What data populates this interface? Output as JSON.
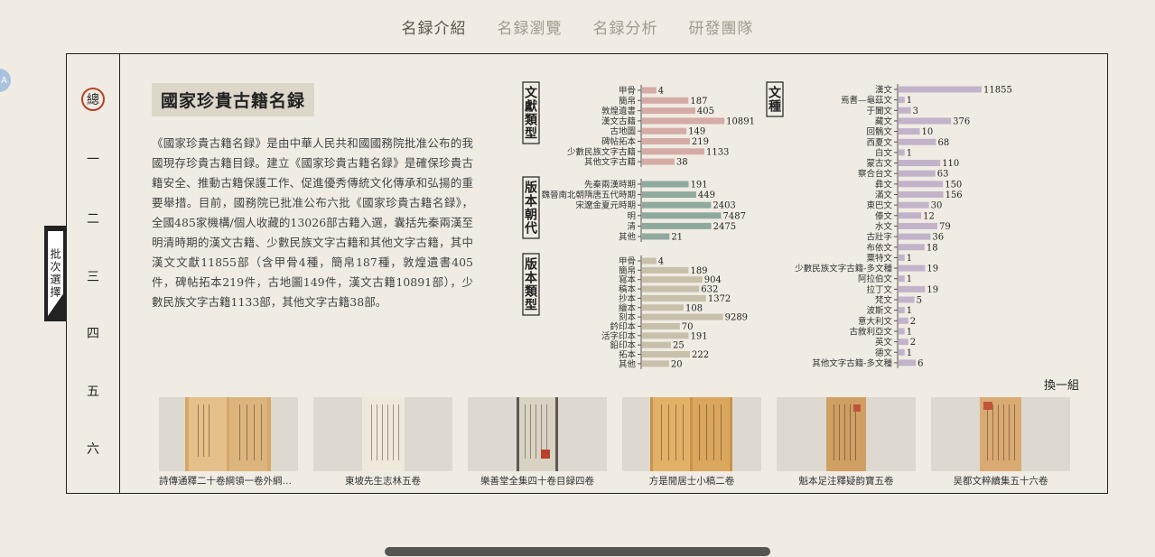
{
  "nav": {
    "items": [
      "名録介紹",
      "名録瀏覽",
      "名録分析",
      "研發團隊"
    ],
    "active_index": 0
  },
  "avatar": {
    "text": "A"
  },
  "sidebar": {
    "items": [
      "總",
      "一",
      "二",
      "三",
      "四",
      "五",
      "六"
    ],
    "active_index": 0
  },
  "batch_tab": {
    "label": "批次選擇"
  },
  "intro": {
    "title": "國家珍貴古籍名録",
    "body": "《國家珍貴古籍名録》是由中華人民共和國國務院批准公布的我國現存珍貴古籍目録。建立《國家珍貴古籍名録》是確保珍貴古籍安全、推動古籍保護工作、促進優秀傳統文化傳承和弘揚的重要舉措。目前，國務院已批准公布六批《國家珍貴古籍名録》，全國485家機構/個人收藏的13026部古籍入選，囊括先秦兩漢至明清時期的漢文古籍、少數民族文字古籍和其他文字古籍，其中漢文文獻11855部（含甲骨4種，簡帛187種，敦煌遺書405件，碑帖拓本219件，古地圖149件，漢文古籍10891部），少數民族文字古籍1133部，其他文字古籍38部。"
  },
  "chart_data": [
    {
      "type": "bar",
      "title": "文獻類型",
      "categories": [
        "甲骨",
        "簡帛",
        "敦煌遺書",
        "漢文古籍",
        "古地圖",
        "碑帖拓本",
        "少數民族文字古籍",
        "其他文字古籍"
      ],
      "values": [
        4,
        187,
        405,
        10891,
        149,
        219,
        1133,
        38
      ],
      "color": "#d4aba7"
    },
    {
      "type": "bar",
      "title": "版本朝代",
      "categories": [
        "先秦兩漢時期",
        "魏晉南北朝隋唐五代時期",
        "宋遼金夏元時期",
        "明",
        "清",
        "其他"
      ],
      "values": [
        191,
        449,
        2403,
        7487,
        2475,
        21
      ],
      "color": "#8fa99e"
    },
    {
      "type": "bar",
      "title": "版本類型",
      "categories": [
        "甲骨",
        "簡帛",
        "寫本",
        "稿本",
        "抄本",
        "繪本",
        "刻本",
        "鈐印本",
        "活字印本",
        "鉛印本",
        "拓本",
        "其他"
      ],
      "values": [
        4,
        189,
        904,
        632,
        1372,
        108,
        9289,
        70,
        191,
        25,
        222,
        20
      ],
      "color": "#c7c0aa"
    },
    {
      "type": "bar",
      "title": "文種",
      "categories": [
        "漢文",
        "焉耆—龜茲文",
        "于闐文",
        "藏文",
        "回鶻文",
        "西夏文",
        "白文",
        "蒙古文",
        "察合台文",
        "彝文",
        "滿文",
        "東巴文",
        "傣文",
        "水文",
        "古壯字",
        "布依文",
        "粟特文",
        "少數民族文字古籍-多文種",
        "阿拉伯文",
        "拉丁文",
        "梵文",
        "波斯文",
        "意大利文",
        "古敘利亞文",
        "英文",
        "德文",
        "其他文字古籍-多文種"
      ],
      "values": [
        11855,
        1,
        3,
        376,
        10,
        68,
        1,
        110,
        63,
        150,
        156,
        30,
        12,
        79,
        36,
        18,
        1,
        19,
        1,
        19,
        5,
        1,
        2,
        1,
        2,
        1,
        6
      ],
      "color": "#c2b3cb"
    }
  ],
  "change_group": {
    "label": "換一組"
  },
  "books": [
    {
      "caption": "詩傳通釋二十卷綱領一卷外綱領一卷"
    },
    {
      "caption": "東坡先生志林五卷"
    },
    {
      "caption": "樂善堂全集四十卷目録四卷"
    },
    {
      "caption": "方是閒居士小稿二卷"
    },
    {
      "caption": "魁本足注釋疑韵寶五卷"
    },
    {
      "caption": "吴都文粹續集五十六卷"
    }
  ],
  "colors": {
    "accent_circle": "#b8412b",
    "doc_type_bar": "#d4aba7",
    "dynasty_bar": "#8fa99e",
    "edition_bar": "#c7c0aa",
    "language_bar": "#c2b3cb"
  }
}
